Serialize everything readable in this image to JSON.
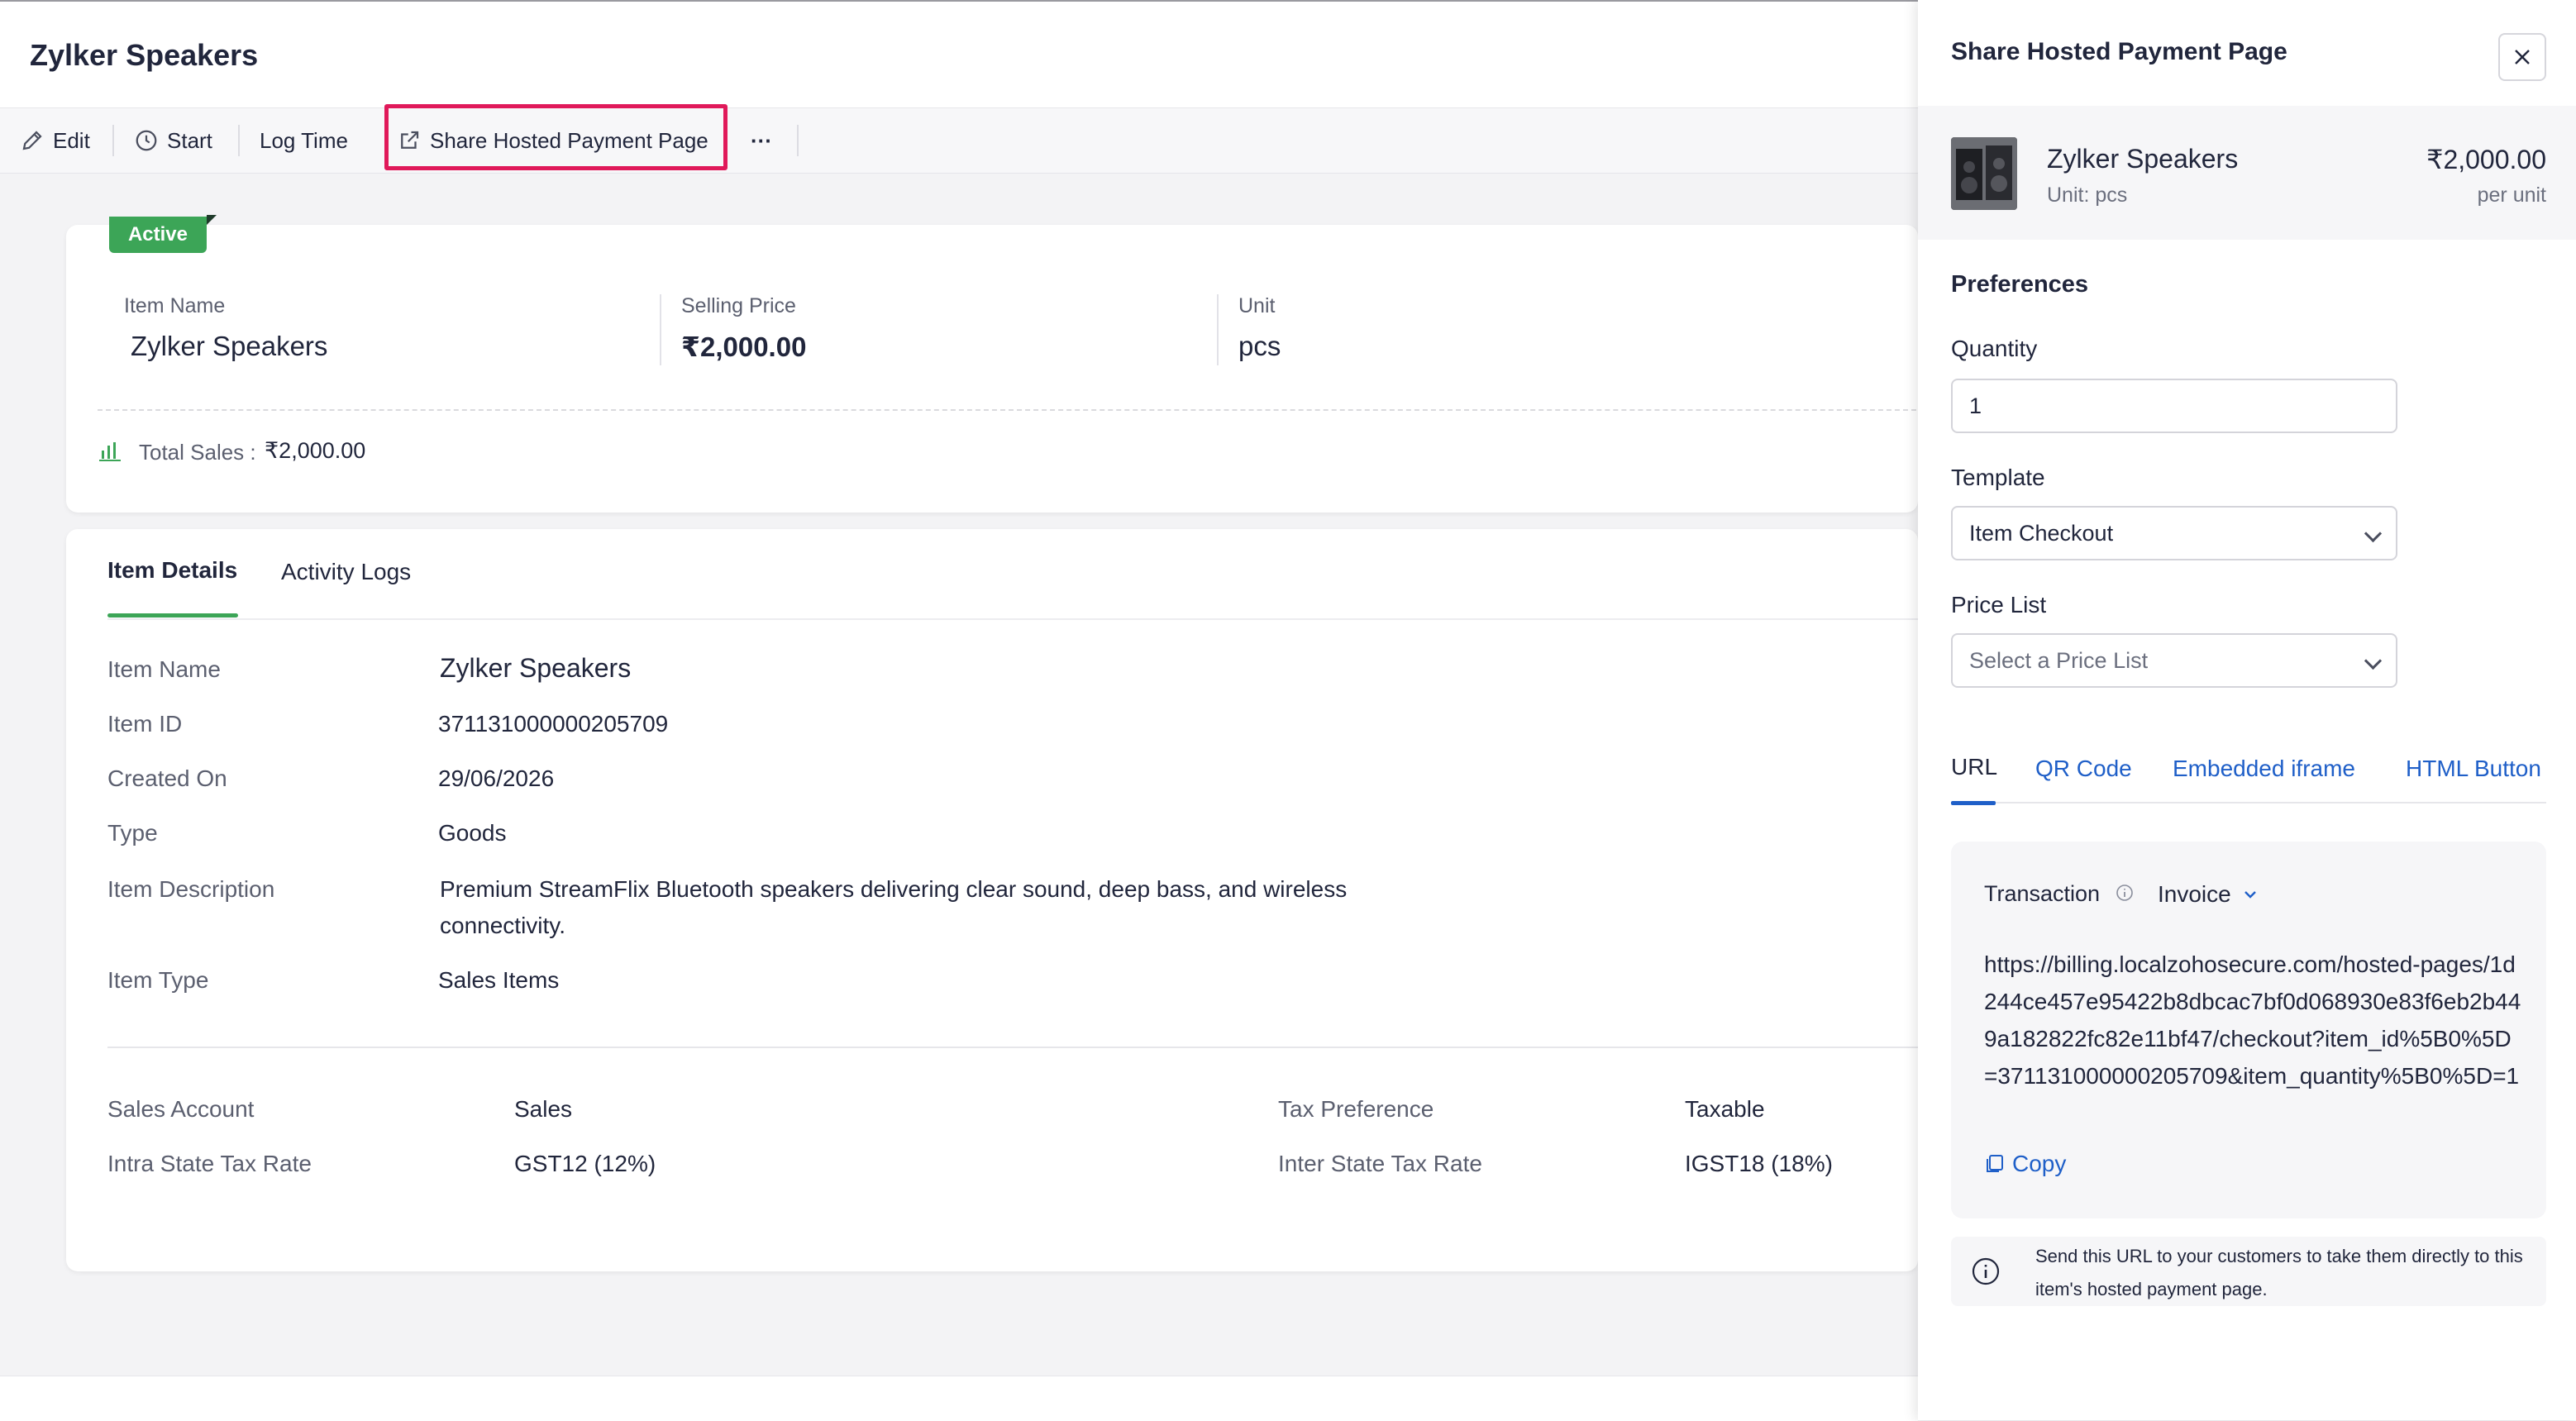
{
  "header": {
    "title": "Zylker Speakers"
  },
  "toolbar": {
    "edit": "Edit",
    "start": "Start",
    "log_time": "Log Time",
    "share": "Share Hosted Payment Page",
    "more": "···"
  },
  "summary": {
    "status": "Active",
    "item_name_label": "Item Name",
    "item_name": "Zylker Speakers",
    "selling_price_label": "Selling Price",
    "selling_price": "₹2,000.00",
    "unit_label": "Unit",
    "unit": "pcs",
    "total_sales_label": "Total Sales :",
    "total_sales": "₹2,000.00"
  },
  "tabs": {
    "item_details": "Item Details",
    "activity_logs": "Activity Logs"
  },
  "details": [
    {
      "label": "Item Name",
      "value": "Zylker Speakers"
    },
    {
      "label": "Item ID",
      "value": "371131000000205709"
    },
    {
      "label": "Created On",
      "value": "29/06/2026"
    },
    {
      "label": "Type",
      "value": "Goods"
    },
    {
      "label": "Item Description",
      "value": "Premium StreamFlix Bluetooth speakers delivering clear sound, deep bass, and wireless",
      "value2": "connectivity."
    },
    {
      "label": "Item Type",
      "value": "Sales Items"
    }
  ],
  "accounts": {
    "sales_account_label": "Sales Account",
    "sales_account": "Sales",
    "intra_label": "Intra State Tax Rate",
    "intra": "GST12 (12%)",
    "tax_pref_label": "Tax Preference",
    "tax_pref": "Taxable",
    "inter_label": "Inter State Tax Rate",
    "inter": "IGST18 (18%)"
  },
  "drawer": {
    "title": "Share Hosted Payment Page",
    "item_name": "Zylker Speakers",
    "item_unit": "Unit: pcs",
    "price": "₹2,000.00",
    "per_unit": "per unit",
    "preferences": "Preferences",
    "quantity_label": "Quantity",
    "quantity": "1",
    "template_label": "Template",
    "template": "Item Checkout",
    "price_list_label": "Price List",
    "price_list_placeholder": "Select a Price List",
    "tabs": {
      "url": "URL",
      "qr": "QR Code",
      "iframe": "Embedded iframe",
      "html_button": "HTML Button"
    },
    "transaction_label": "Transaction",
    "transaction_value": "Invoice",
    "url": "https://billing.localzohosecure.com/hosted-pages/1d244ce457e95422b8dbcac7bf0d068930e83f6eb2b449a182822fc82e11bf47/checkout?item_id%5B0%5D=371131000000205709&item_quantity%5B0%5D=1",
    "copy": "Copy",
    "info": "Send this URL to your customers to take them directly to this item's hosted payment page."
  },
  "colors": {
    "accent_green": "#3ca557",
    "link_blue": "#1f5fc8",
    "highlight_pink": "#e0195a"
  }
}
